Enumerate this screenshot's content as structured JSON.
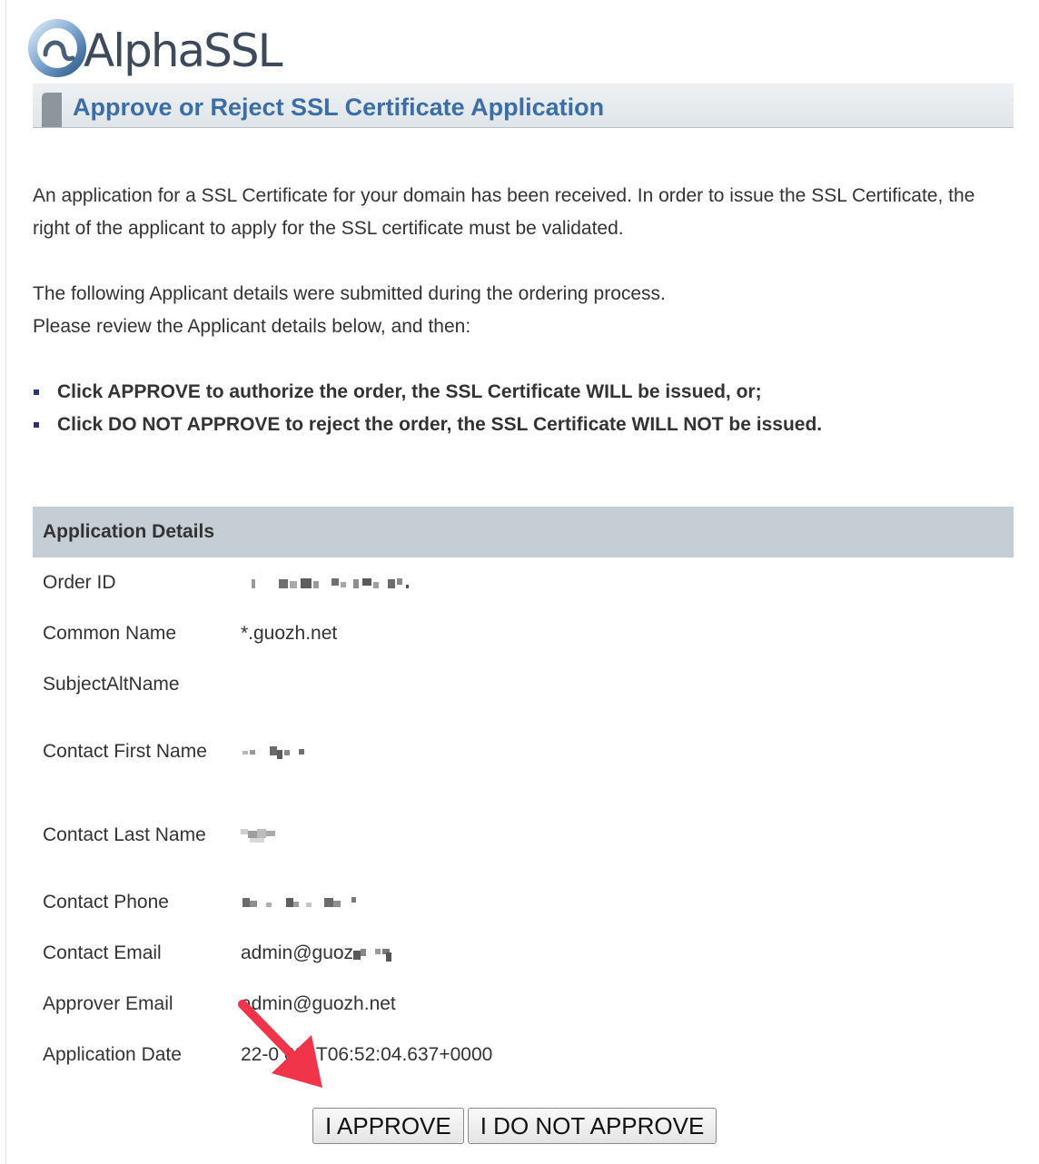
{
  "header": {
    "logo_text": "AlphaSSL",
    "page_title": "Approve or Reject SSL Certificate Application"
  },
  "intro": {
    "paragraph1": "An application for a SSL Certificate for your domain has been received. In order to issue the SSL Certificate, the right of the applicant to apply for the SSL certificate must be validated.",
    "paragraph2_line1": "The following Applicant details were submitted during the ordering process.",
    "paragraph2_line2": "Please review the Applicant details below, and then:"
  },
  "instructions": [
    "Click APPROVE to authorize the order, the SSL Certificate WILL be issued, or;",
    "Click DO NOT APPROVE to reject the order, the SSL Certificate WILL NOT be issued."
  ],
  "details": {
    "header": "Application Details",
    "rows": [
      {
        "label": "Order ID",
        "value": ""
      },
      {
        "label": "Common Name",
        "value": "*.guozh.net"
      },
      {
        "label": "SubjectAltName",
        "value": ""
      },
      {
        "label": "Contact First Name",
        "value": ""
      },
      {
        "label": "Contact Last Name",
        "value": ""
      },
      {
        "label": "Contact Phone",
        "value": ""
      },
      {
        "label": "Contact Email",
        "value": "admin@guoz"
      },
      {
        "label": "Approver Email",
        "value": "admin@guozh.net"
      },
      {
        "label": "Application Date",
        "value": "22-0 021T06:52:04.637+0000"
      }
    ]
  },
  "buttons": {
    "approve": "I APPROVE",
    "reject": "I DO NOT APPROVE"
  },
  "colors": {
    "title": "#3b6ea5",
    "table_header": "#c4ced4",
    "arrow": "#f0344a",
    "bullet": "#2f2f6e"
  },
  "icons": {
    "logo": "alpha-ring-logo-icon",
    "annotation": "red-arrow-icon",
    "bullet": "square-bullet-icon"
  }
}
